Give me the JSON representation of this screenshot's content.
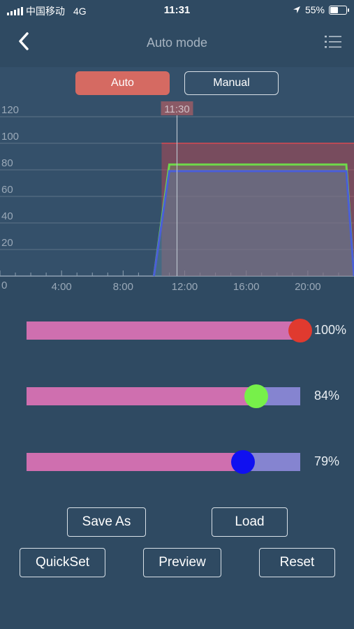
{
  "status": {
    "carrier": "中国移动",
    "network": "4G",
    "time": "11:31",
    "battery": "55%",
    "battery_level": 0.55
  },
  "nav": {
    "title": "Auto mode",
    "back_icon": "chevron-left-icon",
    "menu_icon": "list-menu-icon"
  },
  "mode": {
    "auto_label": "Auto",
    "manual_label": "Manual",
    "selected": "Auto",
    "accent": "#d56a62"
  },
  "chart_data": {
    "type": "area",
    "current_time_label": "11:30",
    "current_time_hours": 11.5,
    "y_ticks": [
      "120",
      "100",
      "80",
      "60",
      "40",
      "20",
      "0"
    ],
    "ylim": [
      0,
      125
    ],
    "x_ticks": [
      "4:00",
      "8:00",
      "12:00",
      "16:00",
      "20:00"
    ],
    "xlim": [
      0,
      23
    ],
    "series": [
      {
        "color": "#d84a52",
        "x": [
          10.5,
          11,
          22.5,
          23
        ],
        "y": [
          100,
          100,
          100,
          100
        ]
      },
      {
        "color": "#6fd84a",
        "x": [
          10,
          11,
          22.5,
          23
        ],
        "y": [
          0,
          84,
          84,
          0
        ]
      },
      {
        "color": "#4a5ed8",
        "x": [
          10,
          11,
          22.5,
          23
        ],
        "y": [
          0,
          79,
          79,
          0
        ]
      }
    ],
    "grid": true
  },
  "sliders": [
    {
      "value": 100,
      "label": "100%",
      "color": "#e03a2f"
    },
    {
      "value": 84,
      "label": "84%",
      "color": "#77f04a"
    },
    {
      "value": 79,
      "label": "79%",
      "color": "#1010f0"
    }
  ],
  "buttons": {
    "save_as": "Save As",
    "load": "Load",
    "quickset": "QuickSet",
    "preview": "Preview",
    "reset": "Reset"
  }
}
